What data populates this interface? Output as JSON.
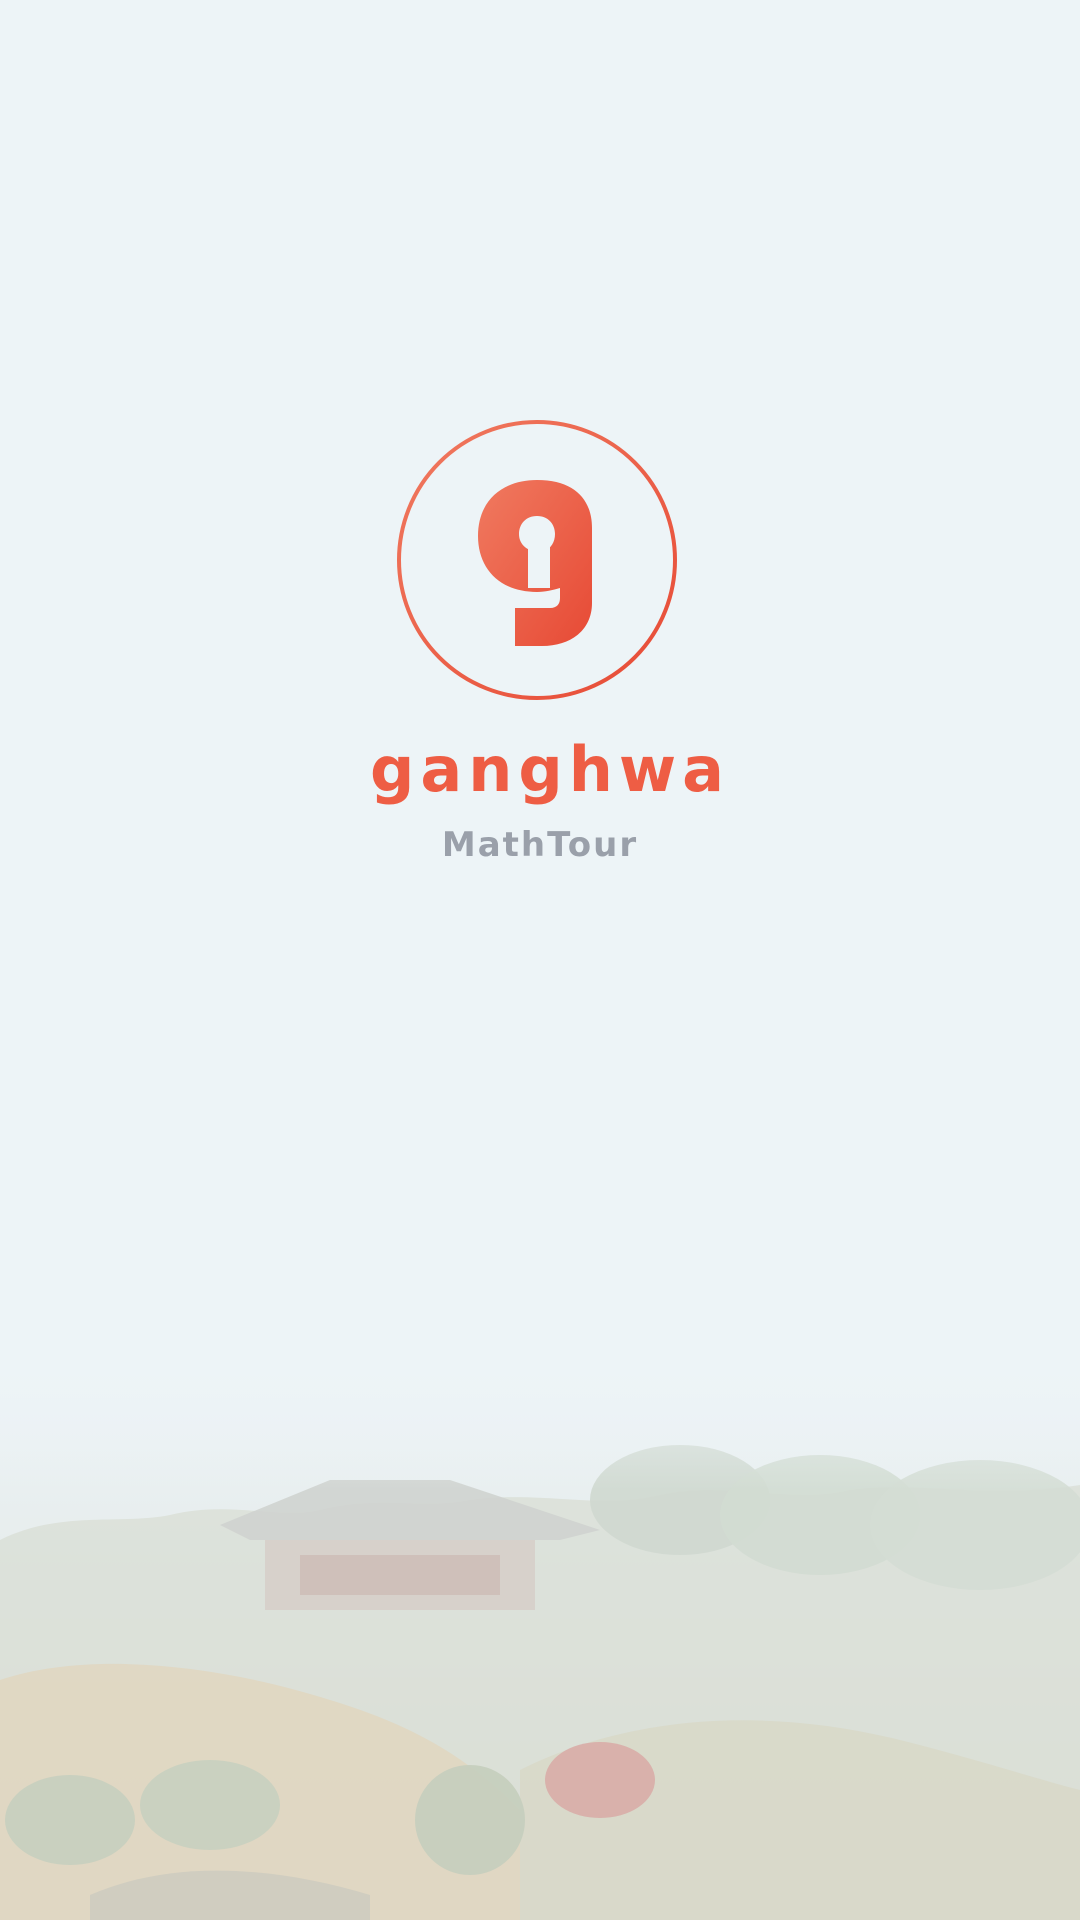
{
  "app": {
    "logo_text": "ganghwa",
    "subtitle": "MathTour",
    "logo_glyph": "g"
  },
  "icons": {
    "logo": "ganghwa-g-circle-icon"
  },
  "colors": {
    "background": "#edf4f7",
    "brand_orange": "#ee5d44",
    "subtitle_gray": "#9aa0aa"
  }
}
